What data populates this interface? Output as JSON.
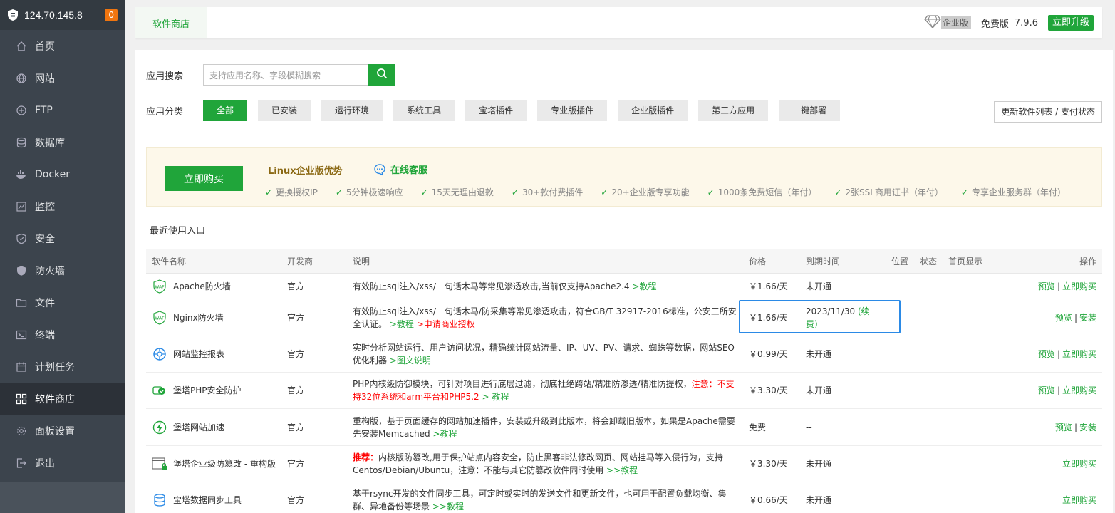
{
  "sidebar": {
    "ip": "124.70.145.8",
    "badge": "0",
    "items": [
      {
        "label": "首页",
        "icon": "home-icon"
      },
      {
        "label": "网站",
        "icon": "globe-icon"
      },
      {
        "label": "FTP",
        "icon": "ftp-icon"
      },
      {
        "label": "数据库",
        "icon": "database-icon"
      },
      {
        "label": "Docker",
        "icon": "docker-icon"
      },
      {
        "label": "监控",
        "icon": "monitor-icon"
      },
      {
        "label": "安全",
        "icon": "shield-icon"
      },
      {
        "label": "防火墙",
        "icon": "firewall-icon"
      },
      {
        "label": "文件",
        "icon": "folder-icon"
      },
      {
        "label": "终端",
        "icon": "terminal-icon"
      },
      {
        "label": "计划任务",
        "icon": "calendar-icon"
      },
      {
        "label": "软件商店",
        "icon": "apps-icon"
      },
      {
        "label": "面板设置",
        "icon": "gear-icon"
      },
      {
        "label": "退出",
        "icon": "logout-icon"
      }
    ]
  },
  "topbar": {
    "tab": "软件商店",
    "enterprise": "企业版",
    "free": "免费版",
    "version": "7.9.6",
    "upgrade": "立即升级"
  },
  "search": {
    "label": "应用搜索",
    "placeholder": "支持应用名称、字段模糊搜索"
  },
  "categories": {
    "label": "应用分类",
    "items": [
      "全部",
      "已安装",
      "运行环境",
      "系统工具",
      "宝塔插件",
      "专业版插件",
      "企业版插件",
      "第三方应用",
      "一键部署"
    ],
    "refresh": "更新软件列表 / 支付状态"
  },
  "promo": {
    "buy": "立即购买",
    "title": "Linux企业版优势",
    "online": "在线客服",
    "benefits": [
      "更换授权IP",
      "5分钟极速响应",
      "15天无理由退款",
      "30+款付费插件",
      "20+企业版专享功能",
      "1000条免费短信（年付）",
      "2张SSL商用证书（年付）",
      "专享企业服务群（年付）"
    ]
  },
  "recent": "最近使用入口",
  "table": {
    "headers": [
      "软件名称",
      "开发商",
      "说明",
      "价格",
      "到期时间",
      "位置",
      "状态",
      "首页显示",
      "操作"
    ],
    "rows": [
      {
        "name": "Apache防火墙",
        "dev": "官方",
        "desc": "有效防止sql注入/xss/一句话木马等常见渗透攻击,当前仅支持Apache2.4",
        "desc_link": ">教程",
        "price": "￥1.66/天",
        "expire": "未开通",
        "ops": [
          "预览",
          "立即购买"
        ]
      },
      {
        "name": "Nginx防火墙",
        "dev": "官方",
        "desc": "有效防止sql注入/xss/一句话木马/防采集等常见渗透攻击，符合GB/T 32917-2016标准，公安三所安全认证。",
        "desc_link": ">教程",
        "desc_red": ">申请商业授权",
        "price": "￥1.66/天",
        "expire": "2023/11/30",
        "renew": "(续费)",
        "ops": [
          "预览",
          "安装"
        ]
      },
      {
        "name": "网站监控报表",
        "dev": "官方",
        "desc": "实时分析网站运行、用户访问状况，精确统计网站流量、IP、UV、PV、请求、蜘蛛等数据，网站SEO优化利器",
        "desc_link": ">图文说明",
        "price": "￥0.99/天",
        "expire": "未开通",
        "ops": [
          "预览",
          "立即购买"
        ]
      },
      {
        "name": "堡塔PHP安全防护",
        "dev": "官方",
        "desc": "PHP内核级防御模块，可针对项目进行底层过滤，彻底杜绝跨站/精准防渗透/精准防提权，",
        "desc_red": "注意：不支持32位系统和arm平台和PHP5.2",
        "desc_link": "> 教程",
        "price": "￥3.30/天",
        "expire": "未开通",
        "ops": [
          "预览",
          "立即购买"
        ]
      },
      {
        "name": "堡塔网站加速",
        "dev": "官方",
        "desc": "重构版，基于页面缓存的网站加速插件，安装或升级到此版本，将会卸载旧版本，如果是Apache需要先安装Memcached",
        "desc_link": ">教程",
        "price": "免费",
        "expire": "--",
        "ops": [
          "预览",
          "安装"
        ]
      },
      {
        "name": "堡塔企业级防篡改 - 重构版",
        "dev": "官方",
        "desc_red_prefix": "推荐：",
        "desc": "内核版防篡改,用于保护站点内容安全，防止黑客非法修改网页、网站挂马等入侵行为，支持Centos/Debian/Ubuntu，注意：不能与其它防篡改软件同时使用",
        "desc_link": ">>教程",
        "price": "￥3.30/天",
        "expire": "未开通",
        "ops": [
          "立即购买"
        ]
      },
      {
        "name": "宝塔数据同步工具",
        "dev": "官方",
        "desc": "基于rsync开发的文件同步工具，可定时或实时的发送文件和更新文件，也可用于配置负载均衡、集群、异地备份等场景",
        "desc_link": ">>教程",
        "price": "￥0.66/天",
        "expire": "未开通",
        "ops": [
          "立即购买"
        ]
      }
    ]
  }
}
